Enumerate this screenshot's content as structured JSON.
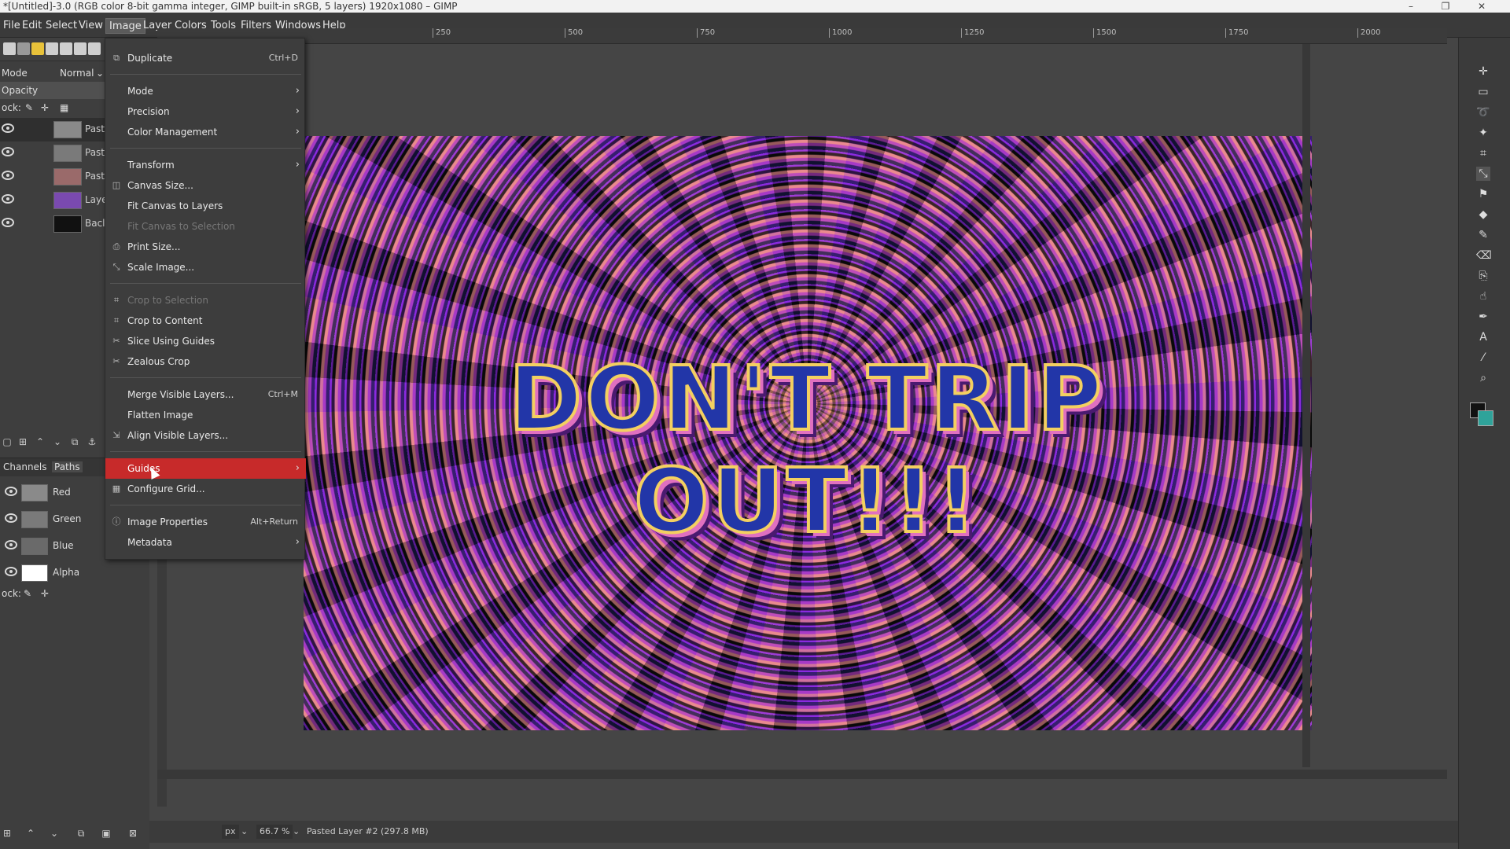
{
  "window": {
    "title": "*[Untitled]-3.0 (RGB color 8-bit gamma integer, GIMP built-in sRGB, 5 layers) 1920x1080 – GIMP",
    "minimize": "–",
    "maximize": "❐",
    "close": "✕"
  },
  "menubar": [
    "File",
    "Edit",
    "Select",
    "View",
    "Image",
    "Layer",
    "Colors",
    "Tools",
    "Filters",
    "Windows",
    "Help"
  ],
  "leftdock": {
    "mode_label": "Mode",
    "mode_value": "Normal",
    "opacity_label": "Opacity",
    "lock_label": "ock:",
    "layers": [
      {
        "name": "Past",
        "thumb": "#8a8a8a"
      },
      {
        "name": "Past",
        "thumb": "#7a7a7a"
      },
      {
        "name": "Past",
        "thumb": "#9a6a6a"
      },
      {
        "name": "Laye",
        "thumb": "#7a4ab0"
      },
      {
        "name": "Bacl",
        "thumb": "#111111"
      }
    ],
    "channel_tabs": [
      "Channels",
      "Paths"
    ],
    "channels": [
      {
        "name": "Red",
        "thumb": "#8a8a8a"
      },
      {
        "name": "Green",
        "thumb": "#7a7a7a"
      },
      {
        "name": "Blue",
        "thumb": "#6a6a6a"
      },
      {
        "name": "Alpha",
        "thumb": "#ffffff"
      }
    ],
    "lock_label2": "ock:"
  },
  "image_menu": {
    "items": [
      {
        "label": "Duplicate",
        "shortcut": "Ctrl+D",
        "icon": "duplicate-icon",
        "glyph": "⧉",
        "enabled": true,
        "submenu": false
      },
      {
        "sep": true
      },
      {
        "label": "Mode",
        "enabled": true,
        "submenu": true
      },
      {
        "label": "Precision",
        "enabled": true,
        "submenu": true
      },
      {
        "label": "Color Management",
        "enabled": true,
        "submenu": true
      },
      {
        "sep": true
      },
      {
        "label": "Transform",
        "enabled": true,
        "submenu": true
      },
      {
        "label": "Canvas Size...",
        "icon": "canvas-size-icon",
        "glyph": "◫",
        "enabled": true,
        "submenu": false
      },
      {
        "label": "Fit Canvas to Layers",
        "enabled": true,
        "submenu": false
      },
      {
        "label": "Fit Canvas to Selection",
        "enabled": false,
        "submenu": false
      },
      {
        "label": "Print Size...",
        "icon": "print-size-icon",
        "glyph": "⎙",
        "enabled": true,
        "submenu": false
      },
      {
        "label": "Scale Image...",
        "icon": "scale-image-icon",
        "glyph": "⤡",
        "enabled": true,
        "submenu": false
      },
      {
        "sep": true
      },
      {
        "label": "Crop to Selection",
        "icon": "crop-icon",
        "glyph": "⌗",
        "enabled": false,
        "submenu": false
      },
      {
        "label": "Crop to Content",
        "icon": "crop-content-icon",
        "glyph": "⌗",
        "enabled": true,
        "submenu": false
      },
      {
        "label": "Slice Using Guides",
        "icon": "slice-icon",
        "glyph": "✂",
        "enabled": true,
        "submenu": false
      },
      {
        "label": "Zealous Crop",
        "icon": "zealous-crop-icon",
        "glyph": "✂",
        "enabled": true,
        "submenu": false
      },
      {
        "sep": true
      },
      {
        "label": "Merge Visible Layers...",
        "shortcut": "Ctrl+M",
        "enabled": true,
        "submenu": false
      },
      {
        "label": "Flatten Image",
        "enabled": true,
        "submenu": false
      },
      {
        "label": "Align Visible Layers...",
        "icon": "align-icon",
        "glyph": "⇲",
        "enabled": true,
        "submenu": false
      },
      {
        "sep": true
      },
      {
        "label": "Guides",
        "enabled": true,
        "submenu": true,
        "highlighted": true
      },
      {
        "label": "Configure Grid...",
        "icon": "grid-icon",
        "glyph": "▦",
        "enabled": true,
        "submenu": false
      },
      {
        "sep": true
      },
      {
        "label": "Image Properties",
        "shortcut": "Alt+Return",
        "icon": "info-icon",
        "glyph": "ⓘ",
        "enabled": true,
        "submenu": false
      },
      {
        "label": "Metadata",
        "enabled": true,
        "submenu": true
      }
    ]
  },
  "ruler": {
    "ticks": [
      "250",
      "500",
      "750",
      "1000",
      "1250",
      "1500",
      "1750",
      "2000"
    ]
  },
  "canvas": {
    "headline": "DON'T TRIP OUT!!!"
  },
  "statusbar": {
    "unit": "px",
    "zoom": "66.7 %",
    "message": "Pasted Layer #2 (297.8 MB)"
  },
  "colors": {
    "menu_highlight": "#c72a2a",
    "foreground": "#111111",
    "background": "#2fa39a"
  }
}
